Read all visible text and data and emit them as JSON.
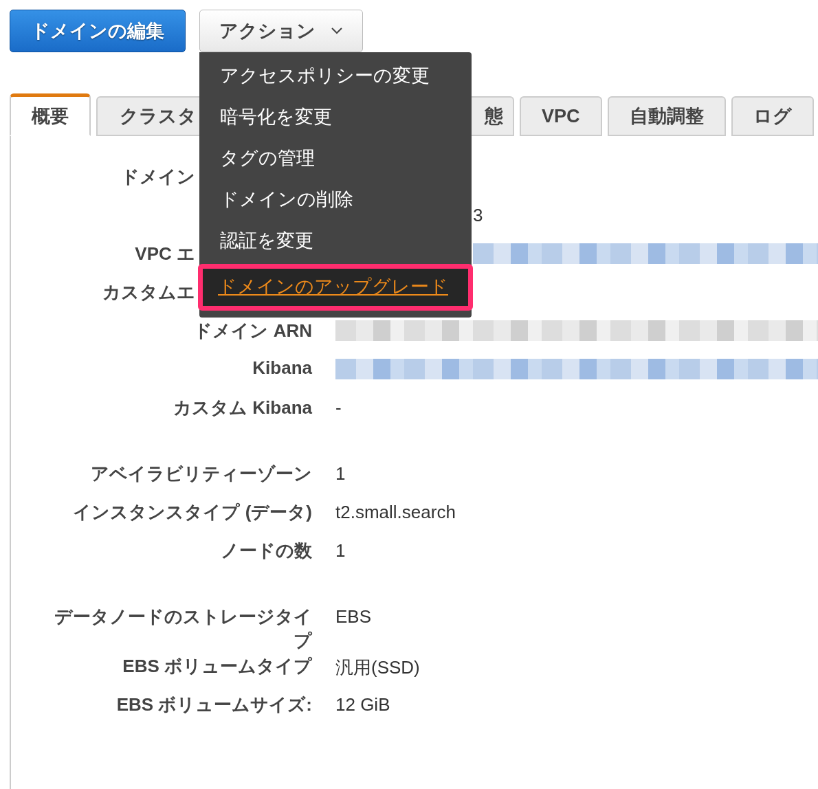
{
  "toolbar": {
    "primary_button": "ドメインの編集",
    "actions_button": "アクション"
  },
  "actions_menu": [
    {
      "label": "アクセスポリシーの変更",
      "selected": false
    },
    {
      "label": "暗号化を変更",
      "selected": false
    },
    {
      "label": "タグの管理",
      "selected": false
    },
    {
      "label": "ドメインの削除",
      "selected": false
    },
    {
      "label": "認証を変更",
      "selected": false
    },
    {
      "label": "ドメインのアップグレード",
      "selected": true
    }
  ],
  "tabs": [
    {
      "label": "概要",
      "selected": true,
      "kind": "full"
    },
    {
      "label": "クラスタ",
      "selected": false,
      "kind": "cut"
    },
    {
      "label": "態",
      "selected": false,
      "kind": "cut-start"
    },
    {
      "label": "VPC",
      "selected": false,
      "kind": "full"
    },
    {
      "label": "自動調整",
      "selected": false,
      "kind": "full"
    },
    {
      "label": "ログ",
      "selected": false,
      "kind": "full"
    }
  ],
  "sections": [
    [
      {
        "label": "ドメイン",
        "kind": "covered"
      },
      {
        "value": "3",
        "kind": "covered"
      },
      {
        "label": "VPC エ",
        "kind": "covered-redacted-link"
      },
      {
        "label": "カスタムエ",
        "kind": "covered"
      },
      {
        "label": "ドメイン ARN",
        "kind": "redacted"
      },
      {
        "label": "Kibana",
        "kind": "redacted-link"
      },
      {
        "label": "カスタム Kibana",
        "value": "-",
        "kind": "text"
      }
    ],
    [
      {
        "label": "アベイラビリティーゾーン",
        "value": "1",
        "kind": "text"
      },
      {
        "label": "インスタンスタイプ (データ)",
        "value": "t2.small.search",
        "kind": "text"
      },
      {
        "label": "ノードの数",
        "value": "1",
        "kind": "text"
      }
    ],
    [
      {
        "label": "データノードのストレージタイプ",
        "value": "EBS",
        "kind": "text"
      },
      {
        "label": "EBS ボリュームタイプ",
        "value": "汎用(SSD)",
        "kind": "text"
      },
      {
        "label": "EBS ボリュームサイズ:",
        "value": "12 GiB",
        "kind": "text"
      }
    ]
  ]
}
